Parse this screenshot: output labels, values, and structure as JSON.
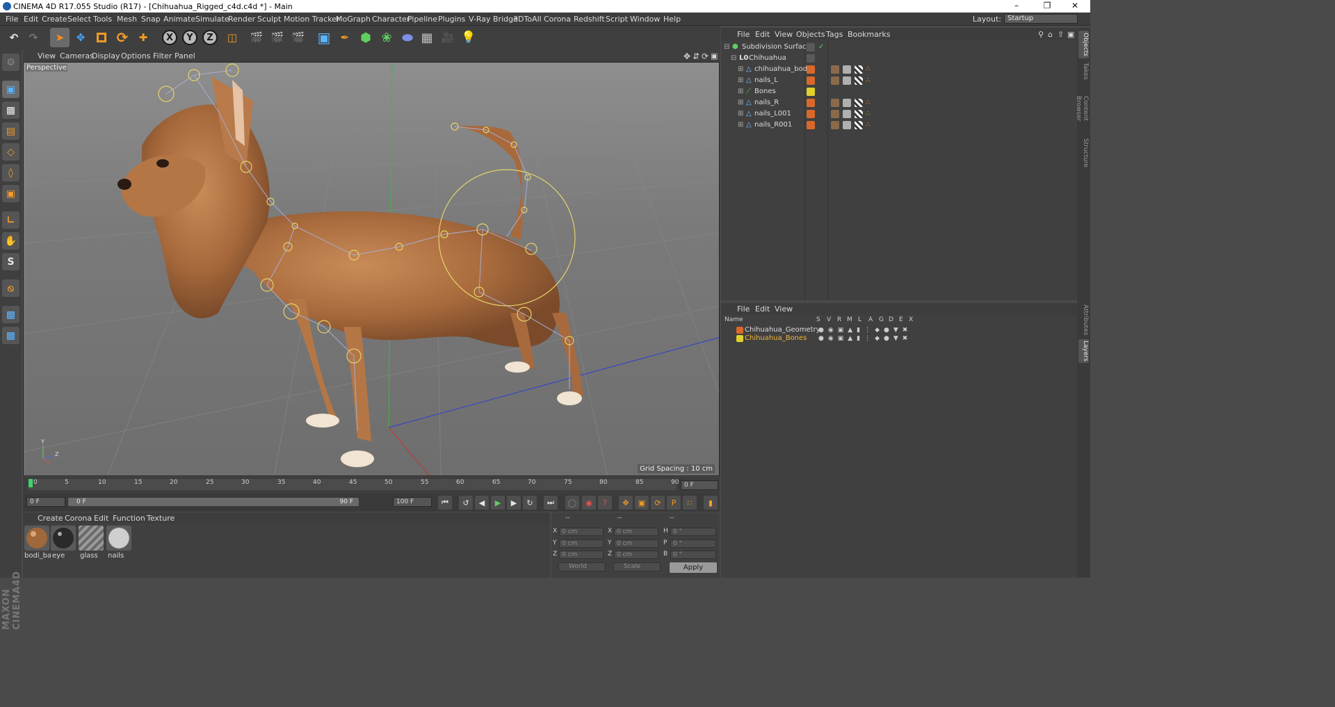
{
  "window": {
    "title": "CINEMA 4D R17.055 Studio (R17) - [Chihuahua_Rigged_c4d.c4d *] - Main"
  },
  "menubar": {
    "items": [
      "File",
      "Edit",
      "Create",
      "Select",
      "Tools",
      "Mesh",
      "Snap",
      "Animate",
      "Simulate",
      "Render",
      "Sculpt",
      "Motion Tracker",
      "MoGraph",
      "Character",
      "Pipeline",
      "Plugins",
      "V-Ray Bridge",
      "3DToAll",
      "Corona",
      "Redshift",
      "Script",
      "Window",
      "Help"
    ],
    "layout_label": "Layout:",
    "layout_value": "Startup"
  },
  "toolbar": {
    "axis_x": "X",
    "axis_y": "Y",
    "axis_z": "Z"
  },
  "viewport": {
    "menu": [
      "View",
      "Cameras",
      "Display",
      "Options",
      "Filter",
      "Panel"
    ],
    "label": "Perspective",
    "grid_spacing": "Grid Spacing : 10 cm"
  },
  "timeline": {
    "ticks": [
      "0",
      "5",
      "10",
      "15",
      "20",
      "25",
      "30",
      "35",
      "40",
      "45",
      "50",
      "55",
      "60",
      "65",
      "70",
      "75",
      "80",
      "85",
      "90"
    ],
    "current_frame": "0 F"
  },
  "transport": {
    "start_frame": "0 F",
    "range_start": "0 F",
    "range_end": "90 F",
    "end_frame": "100 F"
  },
  "materials": {
    "menu": [
      "Create",
      "Corona",
      "Edit",
      "Function",
      "Texture"
    ],
    "items": [
      {
        "name": "bodi_ba",
        "color": "#a0683a"
      },
      {
        "name": "eye",
        "color": "#2a2a2a"
      },
      {
        "name": "glass",
        "color": "#8a8a8a"
      },
      {
        "name": "nails",
        "color": "#cfcfcf"
      }
    ]
  },
  "coordinates": {
    "headers": [
      "--",
      "--",
      "--"
    ],
    "rows": [
      {
        "a": "X",
        "av": "0 cm",
        "b": "X",
        "bv": "0 cm",
        "c": "H",
        "cv": "0 °"
      },
      {
        "a": "Y",
        "av": "0 cm",
        "b": "Y",
        "bv": "0 cm",
        "c": "P",
        "cv": "0 °"
      },
      {
        "a": "Z",
        "av": "0 cm",
        "b": "Z",
        "bv": "0 cm",
        "c": "B",
        "cv": "0 °"
      }
    ],
    "mode1": "World",
    "mode2": "Scale",
    "apply": "Apply"
  },
  "objects": {
    "menu": [
      "File",
      "Edit",
      "View",
      "Objects",
      "Tags",
      "Bookmarks"
    ],
    "items": [
      {
        "name": "Subdivision Surface",
        "color": "#7a7a7a"
      },
      {
        "name": "Chihuahua",
        "color": "#7a7a7a"
      },
      {
        "name": "chihuahua_bodi",
        "color": "#d9692a"
      },
      {
        "name": "nails_L",
        "color": "#d9692a"
      },
      {
        "name": "Bones",
        "color": "#e0d02a"
      },
      {
        "name": "nails_R",
        "color": "#d9692a"
      },
      {
        "name": "nails_L001",
        "color": "#d9692a"
      },
      {
        "name": "nails_R001",
        "color": "#d9692a"
      }
    ]
  },
  "layers": {
    "menu": [
      "File",
      "Edit",
      "View"
    ],
    "header": {
      "name": "Name",
      "cols": [
        "S",
        "V",
        "R",
        "M",
        "L",
        "A",
        "G",
        "D",
        "E",
        "X"
      ]
    },
    "items": [
      {
        "name": "Chihuahua_Geometry",
        "color": "#d9692a"
      },
      {
        "name": "Chihuahua_Bones",
        "color": "#e0d02a"
      }
    ]
  },
  "right_tabs": [
    "Objects",
    "Takes",
    "Content Browser",
    "Structure",
    "Attributes",
    "Layers"
  ]
}
